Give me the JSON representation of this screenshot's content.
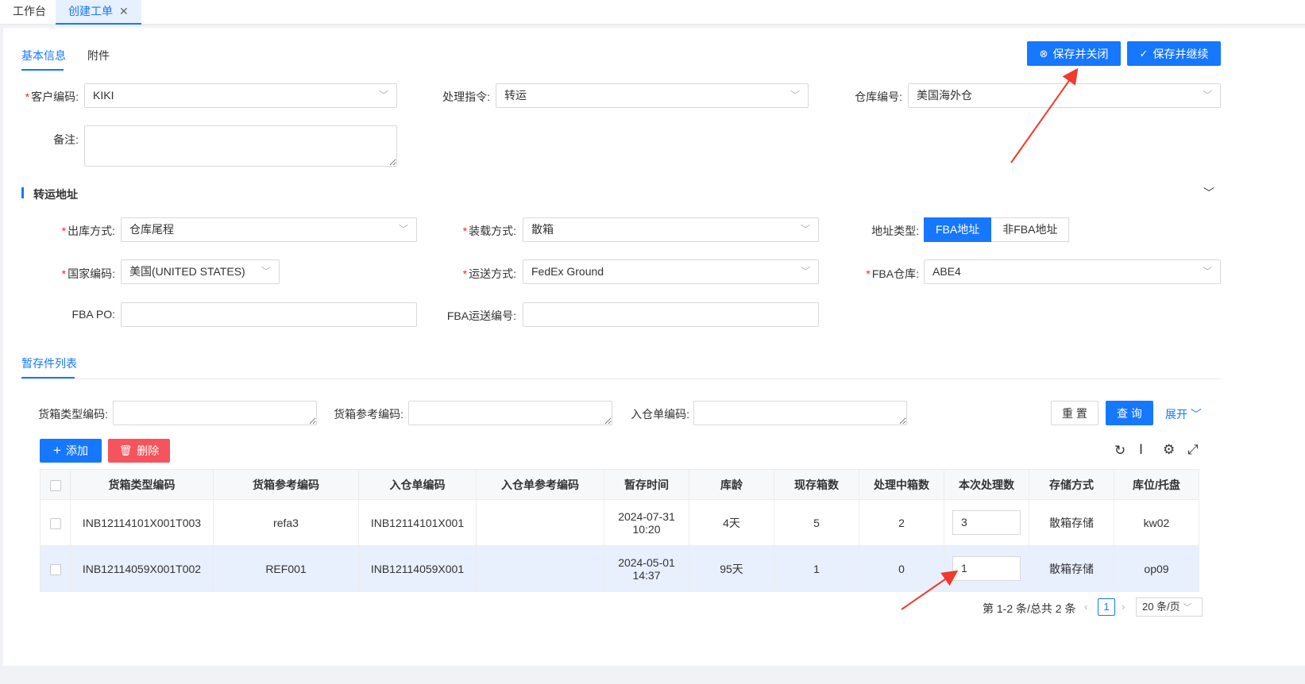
{
  "top_tabs": [
    {
      "label": "工作台"
    },
    {
      "label": "创建工单",
      "close": "✕"
    }
  ],
  "sub_tabs": [
    "基本信息",
    "附件"
  ],
  "actions": {
    "save_close": "保存并关闭",
    "save_continue": "保存并继续"
  },
  "basic": {
    "customer_code_label": "客户编码:",
    "customer_code": "KIKI",
    "instruction_label": "处理指令:",
    "instruction": "转运",
    "warehouse_label": "仓库编号:",
    "warehouse": "美国海外仓",
    "remark_label": "备注:"
  },
  "transfer": {
    "title": "转运地址",
    "out_method_label": "出库方式:",
    "out_method": "仓库尾程",
    "load_method_label": "装载方式:",
    "load_method": "散箱",
    "addr_type_label": "地址类型:",
    "addr_type_options": [
      "FBA地址",
      "非FBA地址"
    ],
    "country_label": "国家编码:",
    "country": "美国(UNITED STATES)",
    "ship_method_label": "运送方式:",
    "ship_method": "FedEx Ground",
    "fba_wh_label": "FBA仓库:",
    "fba_wh": "ABE4",
    "fba_po_label": "FBA PO:",
    "fba_ship_no_label": "FBA运送编号:"
  },
  "staging": {
    "tab": "暂存件列表",
    "box_type_label": "货箱类型编码:",
    "box_ref_label": "货箱参考编码:",
    "inbound_label": "入仓单编码:",
    "reset": "重 置",
    "query": "查 询",
    "expand": "展开",
    "add": "添加",
    "delete": "删除",
    "columns": [
      "货箱类型编码",
      "货箱参考编码",
      "入仓单编码",
      "入仓单参考编码",
      "暂存时间",
      "库龄",
      "现存箱数",
      "处理中箱数",
      "本次处理数",
      "存储方式",
      "库位/托盘"
    ],
    "rows": [
      {
        "box_type": "INB12114101X001T003",
        "box_ref": "refa3",
        "inbound": "INB12114101X001",
        "inbound_ref": "",
        "date": "2024-07-31",
        "time": "10:20",
        "age": "4天",
        "stock": "5",
        "processing": "2",
        "qty": "3",
        "storage": "散箱存储",
        "location": "kw02"
      },
      {
        "box_type": "INB12114059X001T002",
        "box_ref": "REF001",
        "inbound": "INB12114059X001",
        "inbound_ref": "",
        "date": "2024-05-01",
        "time": "14:37",
        "age": "95天",
        "stock": "1",
        "processing": "0",
        "qty": "1",
        "storage": "散箱存储",
        "location": "op09"
      }
    ],
    "pager": {
      "summary": "第 1-2 条/总共 2 条",
      "current": "1",
      "page_size": "20 条/页"
    }
  },
  "colors": {
    "primary": "#1677ff",
    "danger": "#f5545c",
    "annotation": "#f03a2e"
  }
}
